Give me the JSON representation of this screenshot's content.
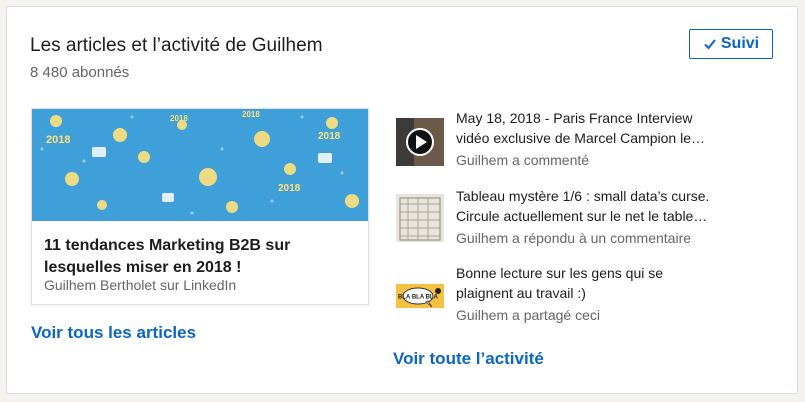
{
  "header": {
    "title": "Les articles et l’activité de Guilhem",
    "followers": "8 480 abonnés",
    "follow_label": "Suivi"
  },
  "article": {
    "title": "11 tendances Marketing B2B sur lesquelles miser en 2018 !",
    "author": "Guilhem Bertholet sur LinkedIn",
    "image_year_label": "2018"
  },
  "links": {
    "all_articles": "Voir tous les articles",
    "all_activity": "Voir toute l’activité"
  },
  "activity": [
    {
      "line1": "May 18, 2018 - Paris France Interview",
      "line2": "vidéo exclusive de Marcel Campion le…",
      "meta": "Guilhem a commenté",
      "thumb": "video-thumbnail"
    },
    {
      "line1": "Tableau mystère 1/6 : small data’s curse.",
      "line2": "Circule actuellement sur le net le table…",
      "meta": "Guilhem a répondu à un commentaire",
      "thumb": "table-thumbnail"
    },
    {
      "line1": "Bonne lecture sur les gens qui se",
      "line2": "plaignent au travail :)",
      "meta": "Guilhem a partagé ceci",
      "thumb": "comic-thumbnail",
      "thumb_text": "BLA BLA BLA"
    }
  ],
  "colors": {
    "accent": "#0a66c2",
    "article_bg": "#3f9fd8"
  }
}
